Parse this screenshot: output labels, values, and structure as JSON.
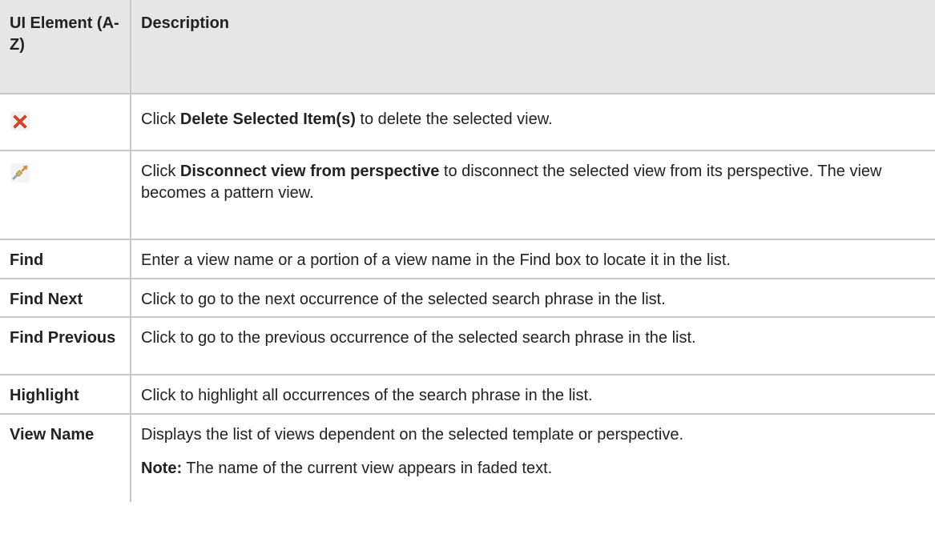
{
  "table": {
    "header": {
      "col1": "UI Element (A-Z)",
      "col2": "Description"
    },
    "rows": {
      "delete": {
        "icon": "delete-red-x-icon",
        "desc_pre": "Click ",
        "desc_bold": "Delete Selected Item(s)",
        "desc_post": " to delete the selected view."
      },
      "disconnect": {
        "icon": "disconnect-plug-icon",
        "desc_pre": "Click ",
        "desc_bold": "Disconnect view from perspective",
        "desc_post": " to disconnect the selected view from its perspective. The view becomes a pattern view."
      },
      "find": {
        "element": "Find",
        "desc": "Enter a view name or a portion of a view name in the Find box to locate it in the list."
      },
      "find_next": {
        "element": "Find Next",
        "desc": "Click to go to the next occurrence of the selected search phrase in the list."
      },
      "find_previous": {
        "element": "Find Previous",
        "desc": "Click to go to the previous occurrence of the selected search phrase in the list."
      },
      "highlight": {
        "element": "Highlight",
        "desc": "Click to highlight all occurrences of the search phrase in the list."
      },
      "view_name": {
        "element": "View Name",
        "desc": "Displays the list of views dependent on the selected template or perspective.",
        "note_label": "Note:",
        "note_text": " The name of the current view appears in faded text."
      }
    }
  },
  "colors": {
    "header_bg": "#e6e6e6",
    "border": "#c8c8c8",
    "text": "#222222",
    "delete_icon": "#e0452b"
  }
}
